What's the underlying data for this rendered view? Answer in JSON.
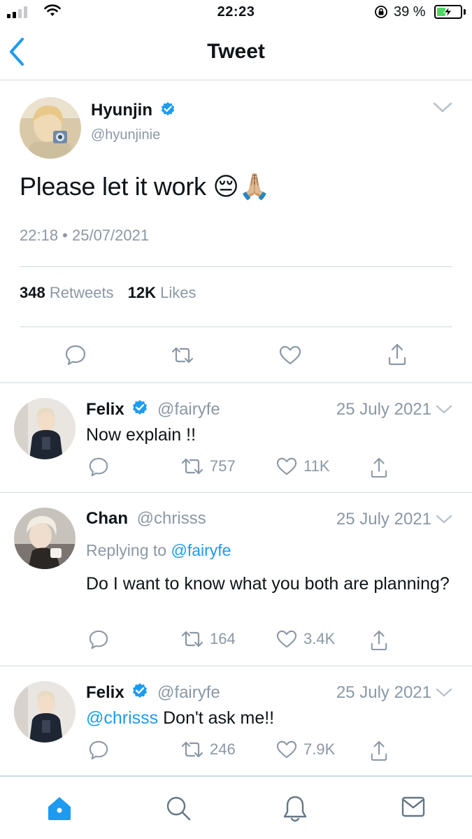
{
  "status_bar": {
    "time": "22:23",
    "battery_percent": "39 %",
    "battery_level": 0.39,
    "signal_bars_on": 2,
    "signal_bars_total": 4
  },
  "nav": {
    "title": "Tweet",
    "back_icon": "chevron-left-icon"
  },
  "main_tweet": {
    "author_name": "Hyunjin",
    "author_handle": "@hyunjinie",
    "verified": true,
    "text": "Please let it work 😔🙏🏼",
    "timestamp": "22:18 • 25/07/2021",
    "retweets_count": "348",
    "retweets_label": "Retweets",
    "likes_count": "12K",
    "likes_label": "Likes",
    "actions": [
      "reply-icon",
      "retweet-icon",
      "like-icon",
      "share-icon"
    ]
  },
  "replies": [
    {
      "author_name": "Felix",
      "author_handle": "@fairyfe",
      "verified": true,
      "date": "25 July 2021",
      "replying_to_label": "",
      "replying_to": "",
      "mention": "",
      "text": "Now explain !!",
      "retweets": "757",
      "likes": "11K"
    },
    {
      "author_name": "Chan",
      "author_handle": "@chrisss",
      "verified": false,
      "date": "25 July 2021",
      "replying_to_label": "Replying to",
      "replying_to": "@fairyfe",
      "mention": "",
      "text": "Do I want to know what you both are planning?",
      "retweets": "164",
      "likes": "3.4K"
    },
    {
      "author_name": "Felix",
      "author_handle": "@fairyfe",
      "verified": true,
      "date": "25 July 2021",
      "replying_to_label": "",
      "replying_to": "",
      "mention": "@chrisss",
      "text": "Don't ask me!!",
      "retweets": "246",
      "likes": "7.9K"
    }
  ],
  "tab_bar": {
    "tabs": [
      "home-icon",
      "search-icon",
      "notifications-icon",
      "messages-icon"
    ],
    "active": "home-icon"
  },
  "colors": {
    "accent": "#1d9bf0",
    "secondary_text": "#8b98a5",
    "divider": "#cfd9de",
    "battery_green": "#4cd964"
  }
}
